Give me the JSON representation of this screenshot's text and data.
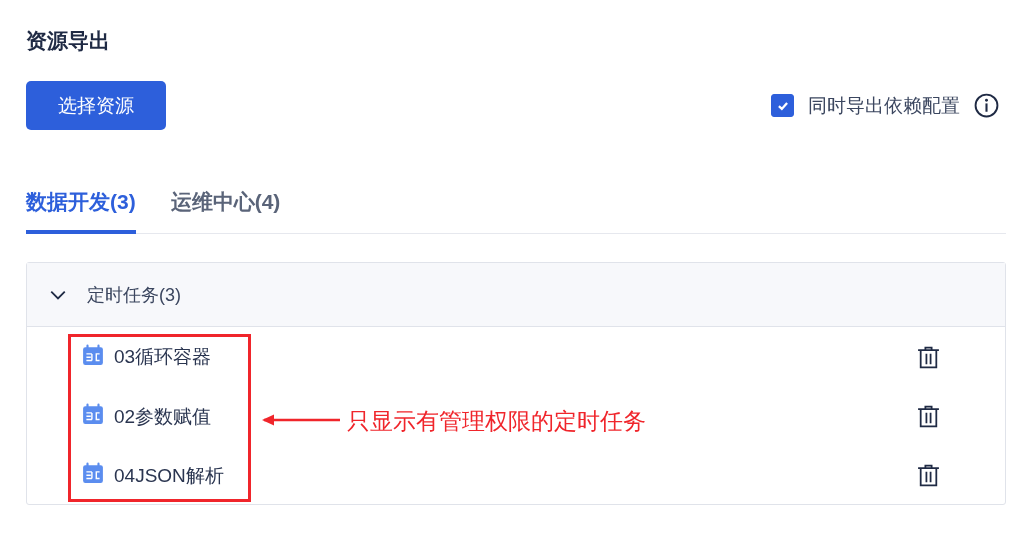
{
  "title": "资源导出",
  "select_button": "选择资源",
  "include_dependencies": {
    "label": "同时导出依赖配置",
    "checked": true
  },
  "tabs": [
    {
      "label": "数据开发(3)",
      "selected": true
    },
    {
      "label": "运维中心(4)",
      "selected": false
    }
  ],
  "group": {
    "label": "定时任务(3)",
    "expanded": true,
    "items": [
      {
        "name": "03循环容器"
      },
      {
        "name": "02参数赋值"
      },
      {
        "name": "04JSON解析"
      }
    ]
  },
  "annotation": "只显示有管理权限的定时任务"
}
